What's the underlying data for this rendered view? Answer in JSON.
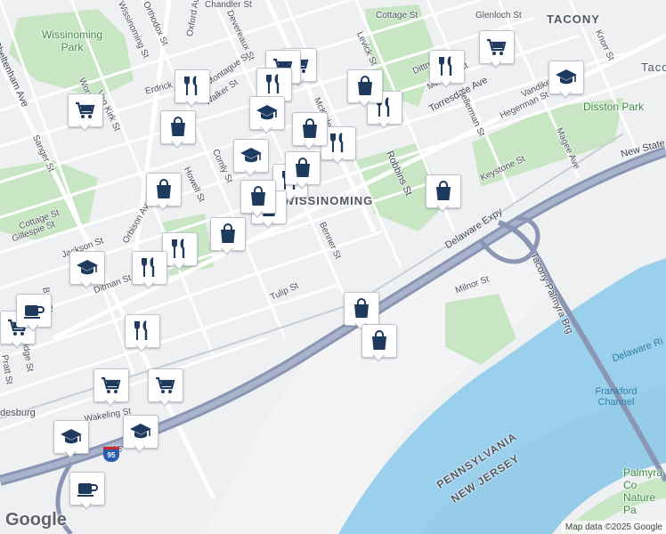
{
  "area_labels": [
    {
      "id": "tacony",
      "text": "TACONY"
    },
    {
      "id": "wissinoming",
      "text": "WISSINOMING"
    },
    {
      "id": "wissinoming-park",
      "text": "Wissinoming Park"
    },
    {
      "id": "disston-park",
      "text": "Disston Park"
    },
    {
      "id": "frankford-channel",
      "text": "Frankford Channel"
    },
    {
      "id": "delaware-river",
      "text": "Delaware Ri"
    },
    {
      "id": "palmyra-cove",
      "text": "Palmyra Co Nature Pa"
    },
    {
      "id": "pennsylvania",
      "text": "PENNSYLVANIA"
    },
    {
      "id": "new-jersey",
      "text": "NEW JERSEY"
    },
    {
      "id": "bridesburg",
      "text": "desburg"
    },
    {
      "id": "tacony-edge",
      "text": "Taco"
    }
  ],
  "street_labels": [
    "Cottage St",
    "Glenloch St",
    "Levick St",
    "Devereaux St",
    "Orthodox St",
    "Chandler St",
    "Wissinoming St",
    "Oxford Ave",
    "Cheltenham Ave",
    "Worrell St",
    "Van Kirk St",
    "Erdrick St",
    "Montague St",
    "Walker St",
    "McKinley St",
    "Torresdale Ave",
    "Hegerman St",
    "Vandike St",
    "Knorr St",
    "Magee Ave",
    "Robbins St",
    "Keystone St",
    "New State Rd",
    "Sanger St",
    "Howell St",
    "Comly St",
    "Benner St",
    "Delaware Expy",
    "Tacony-Palmyra Brg",
    "Milnor St",
    "Tulip St",
    "Ditman St",
    "Jackson St",
    "Gillespie St",
    "Orbison Ave",
    "Bridge St",
    "Pratt St",
    "Wakeling St",
    "Brill St",
    "Hellerman St",
    "I-95",
    "Dittman St",
    "Marsden St",
    "Cottage St"
  ],
  "places": [
    {
      "category": "grocery",
      "icon": "shopping-cart-icon"
    },
    {
      "category": "grocery",
      "icon": "shopping-cart-icon"
    },
    {
      "category": "grocery",
      "icon": "shopping-cart-icon"
    },
    {
      "category": "grocery",
      "icon": "shopping-cart-icon"
    },
    {
      "category": "grocery",
      "icon": "shopping-cart-icon"
    },
    {
      "category": "grocery",
      "icon": "shopping-cart-icon"
    },
    {
      "category": "grocery",
      "icon": "shopping-cart-icon"
    },
    {
      "category": "restaurant",
      "icon": "fork-knife-icon"
    },
    {
      "category": "restaurant",
      "icon": "fork-knife-icon"
    },
    {
      "category": "restaurant",
      "icon": "fork-knife-icon"
    },
    {
      "category": "restaurant",
      "icon": "fork-knife-icon"
    },
    {
      "category": "restaurant",
      "icon": "fork-knife-icon"
    },
    {
      "category": "restaurant",
      "icon": "fork-knife-icon"
    },
    {
      "category": "restaurant",
      "icon": "fork-knife-icon"
    },
    {
      "category": "restaurant",
      "icon": "fork-knife-icon"
    },
    {
      "category": "restaurant",
      "icon": "fork-knife-icon"
    },
    {
      "category": "shopping",
      "icon": "shopping-bag-icon"
    },
    {
      "category": "shopping",
      "icon": "shopping-bag-icon"
    },
    {
      "category": "shopping",
      "icon": "shopping-bag-icon"
    },
    {
      "category": "shopping",
      "icon": "shopping-bag-icon"
    },
    {
      "category": "shopping",
      "icon": "shopping-bag-icon"
    },
    {
      "category": "shopping",
      "icon": "shopping-bag-icon"
    },
    {
      "category": "shopping",
      "icon": "shopping-bag-icon"
    },
    {
      "category": "shopping",
      "icon": "shopping-bag-icon"
    },
    {
      "category": "shopping",
      "icon": "shopping-bag-icon"
    },
    {
      "category": "shopping",
      "icon": "shopping-bag-icon"
    },
    {
      "category": "shopping",
      "icon": "shopping-bag-icon"
    },
    {
      "category": "school",
      "icon": "graduation-cap-icon"
    },
    {
      "category": "school",
      "icon": "graduation-cap-icon"
    },
    {
      "category": "school",
      "icon": "graduation-cap-icon"
    },
    {
      "category": "school",
      "icon": "graduation-cap-icon"
    },
    {
      "category": "school",
      "icon": "graduation-cap-icon"
    },
    {
      "category": "school",
      "icon": "graduation-cap-icon"
    },
    {
      "category": "cafe",
      "icon": "coffee-cup-icon"
    },
    {
      "category": "cafe",
      "icon": "coffee-cup-icon"
    }
  ],
  "highway_shield": "95",
  "branding": {
    "logo": "Google",
    "attribution": "Map data ©2025 Google"
  },
  "colors": {
    "water": "#9bd0ec",
    "park": "#c8e6c4",
    "road": "#ffffff",
    "highway": "#8a96b4",
    "pin_icon": "#1e3a5f",
    "background": "#eff0f2"
  }
}
